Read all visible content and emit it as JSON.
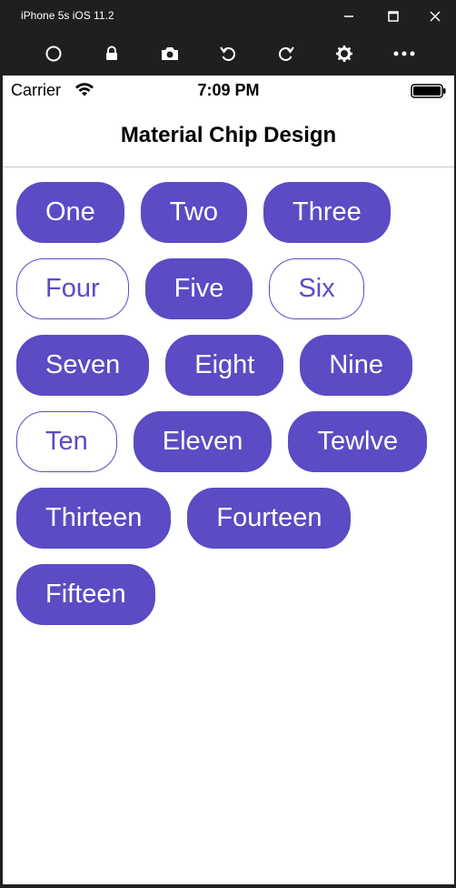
{
  "window": {
    "title": "iPhone 5s iOS 11.2"
  },
  "toolbar": {
    "icons": [
      "home-icon",
      "lock-icon",
      "camera-icon",
      "rotate-left-icon",
      "rotate-right-icon",
      "settings-icon",
      "more-icon"
    ]
  },
  "status_bar": {
    "carrier": "Carrier",
    "time": "7:09 PM"
  },
  "nav": {
    "title": "Material Chip Design"
  },
  "chips": [
    {
      "label": "One",
      "selected": true
    },
    {
      "label": "Two",
      "selected": true
    },
    {
      "label": "Three",
      "selected": true
    },
    {
      "label": "Four",
      "selected": false
    },
    {
      "label": "Five",
      "selected": true
    },
    {
      "label": "Six",
      "selected": false
    },
    {
      "label": "Seven",
      "selected": true
    },
    {
      "label": "Eight",
      "selected": true
    },
    {
      "label": "Nine",
      "selected": true
    },
    {
      "label": "Ten",
      "selected": false
    },
    {
      "label": "Eleven",
      "selected": true
    },
    {
      "label": "Tewlve",
      "selected": true
    },
    {
      "label": "Thirteen",
      "selected": true
    },
    {
      "label": "Fourteen",
      "selected": true
    },
    {
      "label": "Fifteen",
      "selected": true
    }
  ],
  "colors": {
    "accent": "#5b4bc4",
    "chrome": "#1f1f1f"
  }
}
